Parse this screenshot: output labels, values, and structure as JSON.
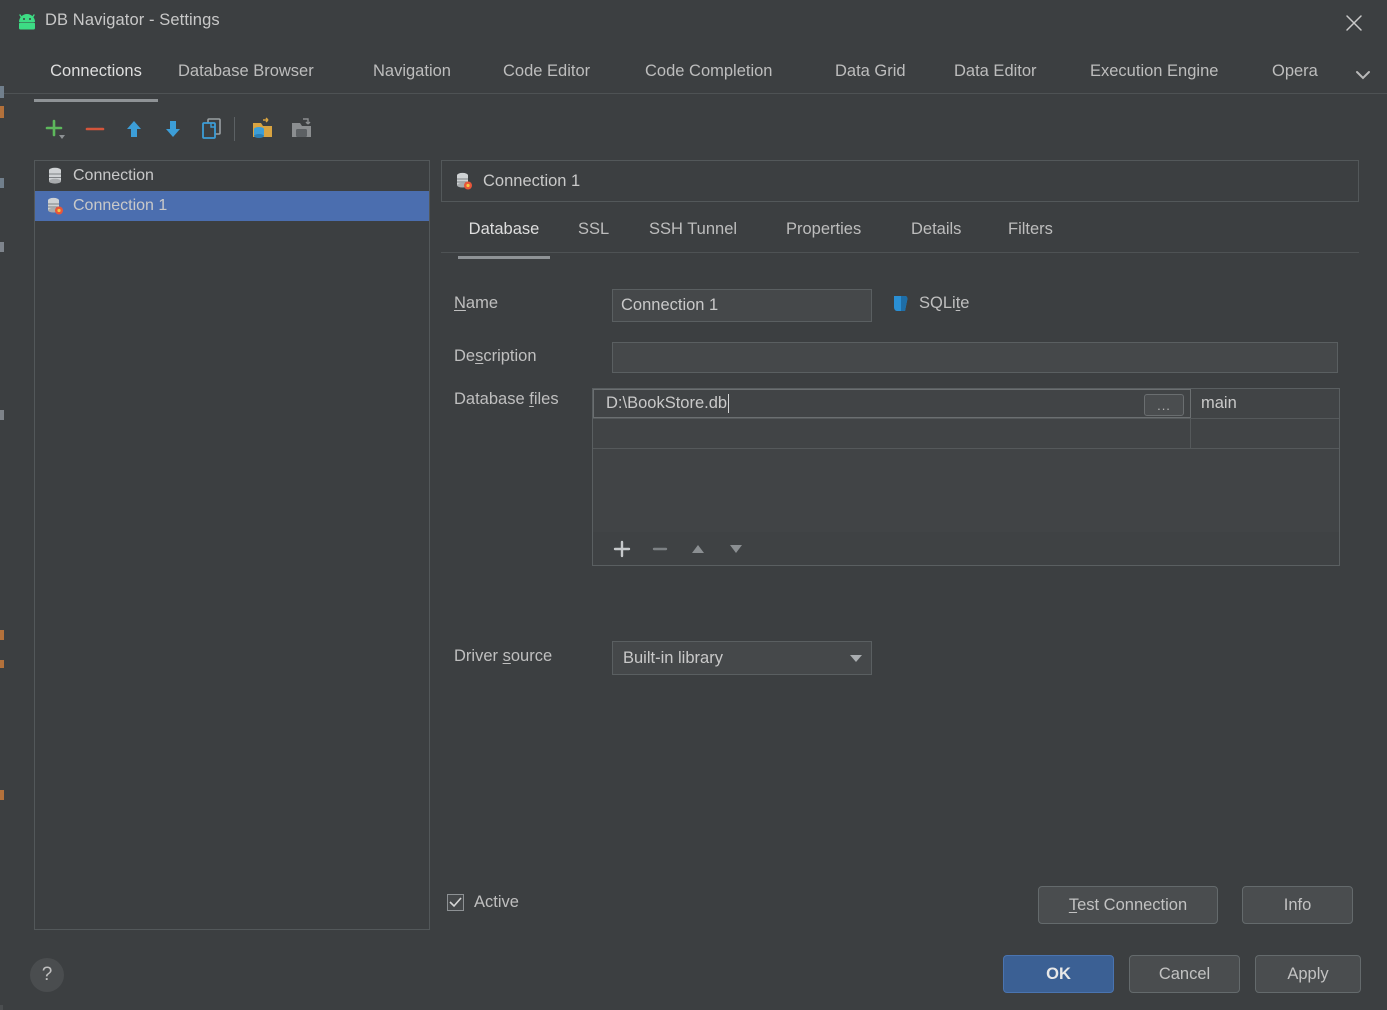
{
  "window": {
    "title": "DB Navigator - Settings",
    "app_icon": "android-robot-icon",
    "close_icon": "close-icon"
  },
  "progress": {
    "fill_color": "#f5a623",
    "track_color": "#d6d6d6"
  },
  "main_tabs": [
    {
      "label": "Connections",
      "active": true
    },
    {
      "label": "Database Browser",
      "active": false
    },
    {
      "label": "Navigation",
      "active": false
    },
    {
      "label": "Code Editor",
      "active": false
    },
    {
      "label": "Code Completion",
      "active": false
    },
    {
      "label": "Data Grid",
      "active": false
    },
    {
      "label": "Data Editor",
      "active": false
    },
    {
      "label": "Execution Engine",
      "active": false
    },
    {
      "label": "Opera",
      "active": false
    }
  ],
  "toolbar": {
    "add": "add-icon",
    "remove": "remove-icon",
    "move_up": "arrow-up-icon",
    "move_down": "arrow-down-icon",
    "duplicate": "duplicate-icon",
    "import": "import-icon",
    "export": "export-icon"
  },
  "connections_list": [
    {
      "label": "Connection",
      "icon": "database-icon",
      "selected": false
    },
    {
      "label": "Connection 1",
      "icon": "database-error-icon",
      "selected": true
    }
  ],
  "panel": {
    "header_title": "Connection 1",
    "header_icon": "database-error-icon",
    "tabs": [
      {
        "label": "Database",
        "active": true
      },
      {
        "label": "SSL",
        "active": false
      },
      {
        "label": "SSH Tunnel",
        "active": false
      },
      {
        "label": "Properties",
        "active": false
      },
      {
        "label": "Details",
        "active": false
      },
      {
        "label": "Filters",
        "active": false
      }
    ]
  },
  "form": {
    "name_label_pre": "N",
    "name_label_mn": "",
    "name_label": "Name",
    "name_value": "Connection 1",
    "db_type_label": "SQLite",
    "db_type_icon": "sqlite-icon",
    "description_label": "Description",
    "description_value": "",
    "description_placeholder": "",
    "database_files_label": "Database files",
    "driver_source_label": "Driver source",
    "driver_source_value": "Built-in library",
    "active_label": "Active",
    "active_checked": true
  },
  "files_table": {
    "rows": [
      {
        "path": "D:\\BookStore.db",
        "schema": "main",
        "editing": true,
        "browse_label": "..."
      },
      {
        "path": "",
        "schema": "",
        "editing": false
      }
    ],
    "toolbar": {
      "add": "add-icon",
      "remove": "remove-icon",
      "move_up": "triangle-up-icon",
      "move_down": "triangle-down-icon"
    }
  },
  "actions": {
    "test_connection": "Test Connection",
    "info": "Info",
    "ok": "OK",
    "cancel": "Cancel",
    "apply": "Apply",
    "help": "?"
  },
  "colors": {
    "background": "#3c3f41",
    "selection": "#4b6eaf",
    "primary_button": "#3b6094",
    "text": "#c9c9c9",
    "accent_orange": "#f5a623"
  }
}
